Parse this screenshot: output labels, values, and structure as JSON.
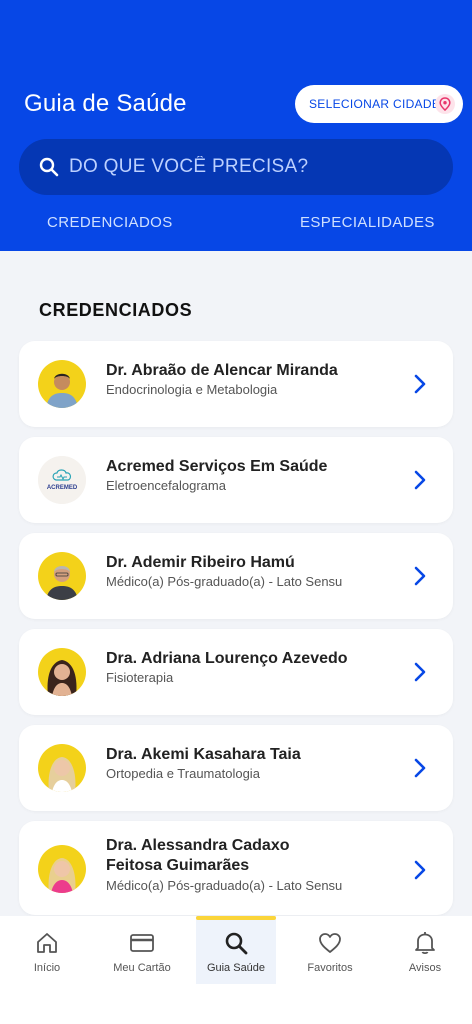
{
  "header": {
    "title": "Guia de Saúde",
    "city_button": "SELECIONAR CIDADE",
    "search_placeholder": "DO QUE VOCÊ PRECISA?",
    "tabs": [
      "CREDENCIADOS",
      "ESPECIALIDADES"
    ]
  },
  "section_title": "CREDENCIADOS",
  "list": [
    {
      "name": "Dr. Abraão de Alencar Miranda",
      "specialty": "Endocrinologia e Metabologia",
      "avatar": "doctor-photo"
    },
    {
      "name": "Acremed Serviços Em Saúde",
      "specialty": "Eletroencefalograma",
      "avatar": "acremed-logo",
      "logo_text": "ACREMED"
    },
    {
      "name": "Dr. Ademir Ribeiro Hamú",
      "specialty": "Médico(a) Pós-graduado(a) - Lato Sensu",
      "avatar": "doctor-photo"
    },
    {
      "name": "Dra. Adriana Lourenço Azevedo",
      "specialty": "Fisioterapia",
      "avatar": "doctor-photo"
    },
    {
      "name": "Dra. Akemi Kasahara Taia",
      "specialty": "Ortopedia e Traumatologia",
      "avatar": "doctor-photo"
    },
    {
      "name_line1": "Dra. Alessandra Cadaxo",
      "name_line2": "Feitosa Guimarães",
      "specialty": "Médico(a) Pós-graduado(a) - Lato Sensu",
      "avatar": "doctor-photo"
    }
  ],
  "nav": {
    "items": [
      {
        "label": "Início",
        "icon": "home-icon"
      },
      {
        "label": "Meu Cartão",
        "icon": "card-icon"
      },
      {
        "label": "Guia Saúde",
        "icon": "search-icon",
        "active": true
      },
      {
        "label": "Favoritos",
        "icon": "heart-icon"
      },
      {
        "label": "Avisos",
        "icon": "bell-icon"
      }
    ]
  },
  "colors": {
    "primary": "#0747e6",
    "accent": "#fbd53a",
    "pin": "#e8356b"
  }
}
